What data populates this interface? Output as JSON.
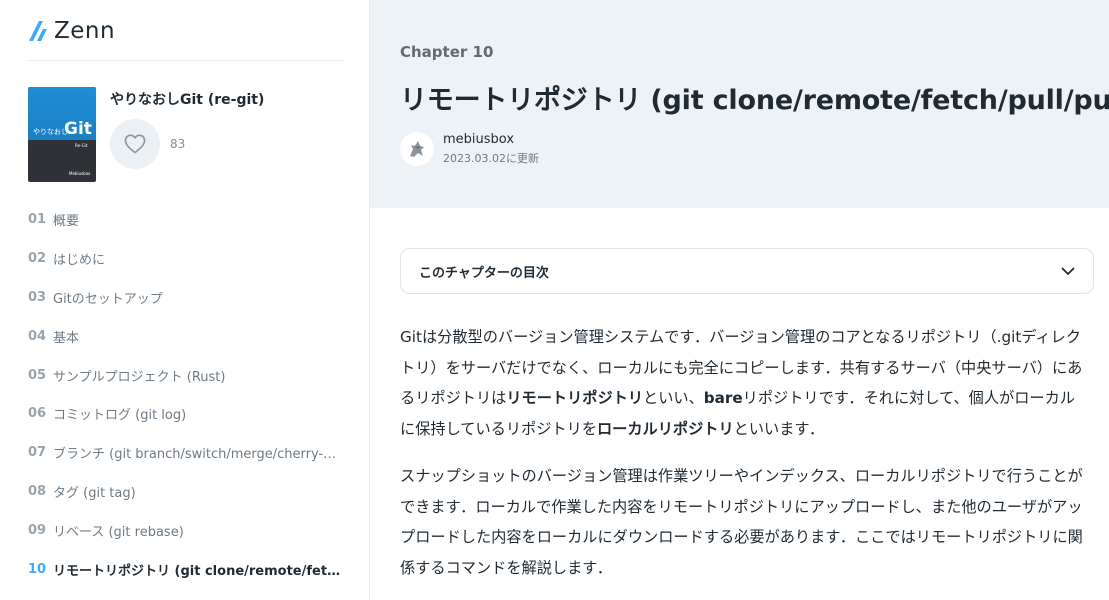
{
  "brand": {
    "name": "Zenn"
  },
  "book": {
    "title": "やりなおしGit (re-git)",
    "cover": {
      "small": "やりなおし",
      "big": "Git",
      "sub": "Re-Git",
      "author": "Mebiusbox"
    },
    "likes": "83"
  },
  "chapters": [
    {
      "num": "01",
      "label": "概要"
    },
    {
      "num": "02",
      "label": "はじめに"
    },
    {
      "num": "03",
      "label": "Gitのセットアップ"
    },
    {
      "num": "04",
      "label": "基本"
    },
    {
      "num": "05",
      "label": "サンプルプロジェクト (Rust)"
    },
    {
      "num": "06",
      "label": "コミットログ (git log)"
    },
    {
      "num": "07",
      "label": "ブランチ (git branch/switch/merge/cherry-pi..."
    },
    {
      "num": "08",
      "label": "タグ (git tag)"
    },
    {
      "num": "09",
      "label": "リベース (git rebase)"
    },
    {
      "num": "10",
      "label": "リモートリポジトリ (git clone/remote/fetc..."
    }
  ],
  "main": {
    "chapter_label": "Chapter 10",
    "title": "リモートリポジトリ (git clone/remote/fetch/pull/push)",
    "author_name": "mebiusbox",
    "updated": "2023.03.02に更新",
    "toc_label": "このチャプターの目次",
    "p1": {
      "a": "Gitは分散型のバージョン管理システムです．バージョン管理のコアとなるリポジトリ（.gitディレクトリ）をサーバだけでなく、ローカルにも完全にコピーします．共有するサーバ（中央サーバ）にあるリポジトリは",
      "b": "リモートリポジトリ",
      "c": "といい、",
      "d": "bare",
      "e": "リポジトリです．それに対して、個人がローカルに保持しているリポジトリを",
      "f": "ローカルリポジトリ",
      "g": "といいます．"
    },
    "p2": "スナップショットのバージョン管理は作業ツリーやインデックス、ローカルリポジトリで行うことができます．ローカルで作業した内容をリモートリポジトリにアップロードし、また他のユーザがアップロードした内容をローカルにダウンロードする必要があります．ここではリモートリポジトリに関係するコマンドを解説します．"
  }
}
